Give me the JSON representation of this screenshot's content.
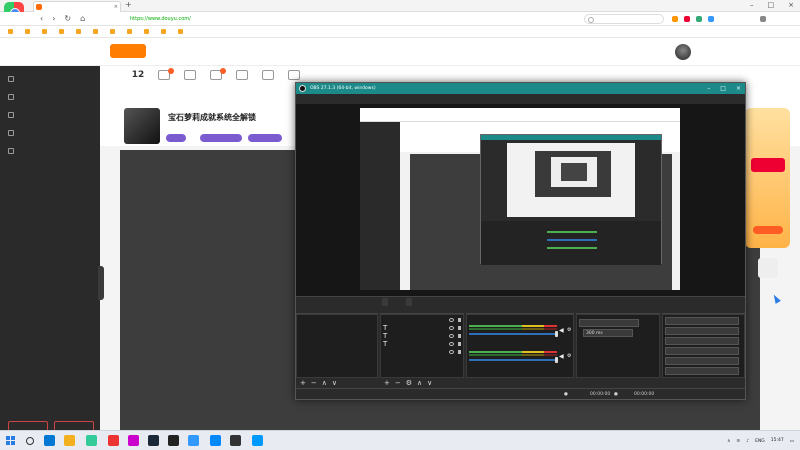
{
  "browser": {
    "tab_title": "",
    "url_host": "https://www.douyu.com/",
    "url_rest": "",
    "search_placeholder": "",
    "bookmarks": [
      "",
      "",
      "",
      "",
      "",
      "",
      "",
      "",
      "",
      "",
      ""
    ],
    "bookmarks_right": ""
  },
  "site": {
    "logo": "",
    "nav": [
      "",
      "",
      "",
      "",
      "",
      ""
    ],
    "categories": [
      {
        "label": "",
        "num": "12",
        "badge": false
      },
      {
        "label": "",
        "num": "",
        "badge": true
      },
      {
        "label": "",
        "num": "",
        "badge": false
      },
      {
        "label": "",
        "num": "",
        "badge": true
      },
      {
        "label": "",
        "num": "",
        "badge": false
      },
      {
        "label": "",
        "num": "",
        "badge": false
      },
      {
        "label": "",
        "num": "",
        "badge": false
      }
    ],
    "sidebar": {
      "items": [
        "",
        "",
        "",
        "",
        ""
      ],
      "section1": "",
      "grid1": [
        "",
        "",
        "",
        "",
        "",
        "",
        "",
        "",
        "",
        "",
        "",
        "",
        "",
        "",
        "",
        "",
        "",
        "",
        "",
        "",
        "",
        "",
        "",
        "",
        "",
        "",
        ""
      ],
      "section2": "",
      "grid2": [
        "",
        "",
        "",
        "",
        "",
        "",
        "",
        "",
        "",
        "",
        "",
        "",
        "",
        "",
        "",
        ""
      ],
      "section3": "",
      "grid3": [
        "",
        "",
        "",
        "",
        "",
        "",
        "",
        "",
        "",
        "",
        "",
        ""
      ],
      "btn1": "",
      "btn2": ""
    },
    "room": {
      "title": "宝石萝莉成就系统全解锁",
      "meta": "",
      "pill1": "",
      "pill2": "",
      "pill3": ""
    },
    "ad": {
      "title": "",
      "button": ""
    }
  },
  "obs": {
    "title": "OBS 27.1.3 (64-bit, windows)",
    "menu": [
      "",
      "",
      "",
      "",
      "",
      ""
    ],
    "scene_bar_label": "",
    "scene_bar_btn1": "",
    "scene_bar_btn2": "",
    "dock_headers": [
      "",
      "",
      "",
      "",
      ""
    ],
    "scenes": [
      ""
    ],
    "sources": [
      {
        "name": "",
        "text_icon": false
      },
      {
        "name": "",
        "text_icon": true
      },
      {
        "name": "",
        "text_icon": true
      },
      {
        "name": "",
        "text_icon": true
      },
      {
        "name": "",
        "text_icon": false
      }
    ],
    "mixer": [
      {
        "name": "",
        "value": ""
      },
      {
        "name": "",
        "value": ""
      }
    ],
    "transition": {
      "type": "",
      "duration_label": "",
      "duration_value": "300 ms"
    },
    "controls": [
      "",
      "",
      "",
      "",
      "",
      ""
    ],
    "status": {
      "live": "00:00:00",
      "rec": "00:00:00",
      "cpu": "",
      "fps": ""
    }
  },
  "taskbar": {
    "tray_lang": "ENG",
    "time": "15:47",
    "date": ""
  },
  "colors": {
    "accent": "#ff5d23",
    "obs_title": "#1d8a8a",
    "sidebar": "#2a2a2a"
  }
}
